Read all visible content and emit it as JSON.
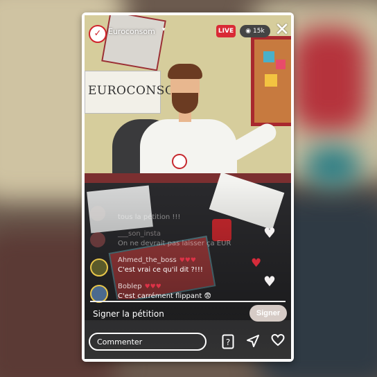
{
  "header": {
    "brand_name": "Euroconsom",
    "brand_chevron": "▾",
    "live_label": "LIVE",
    "viewers": "15k",
    "close_symbol": "✕"
  },
  "scene": {
    "poster_text": "EUROCONSOM"
  },
  "comments": [
    {
      "name": "",
      "text": "tous la pétition !!!",
      "hearts": "",
      "faded": true,
      "avatar_color": "#d9d2cf"
    },
    {
      "name": "___son_insta",
      "text": "On ne devrait pas laisser ça EUR",
      "hearts": "",
      "faded": true,
      "avatar_color": "#b75353"
    },
    {
      "name": "Ahmed_the_boss",
      "text": "C'est vrai ce qu'il dit ?!!!",
      "hearts": "♥♥♥",
      "faded": false,
      "avatar_color": "#5a5a2a"
    },
    {
      "name": "Boblep",
      "text": "C'est carrément flippant 😨",
      "hearts": "♥♥♥",
      "faded": false,
      "avatar_color": "#4b6a8f"
    }
  ],
  "petition": {
    "label": "Signer la pétition",
    "button_label": "Signer"
  },
  "composer": {
    "placeholder": "Commenter"
  },
  "toolbar_icons": [
    "question-card-icon",
    "send-icon",
    "heart-icon"
  ]
}
